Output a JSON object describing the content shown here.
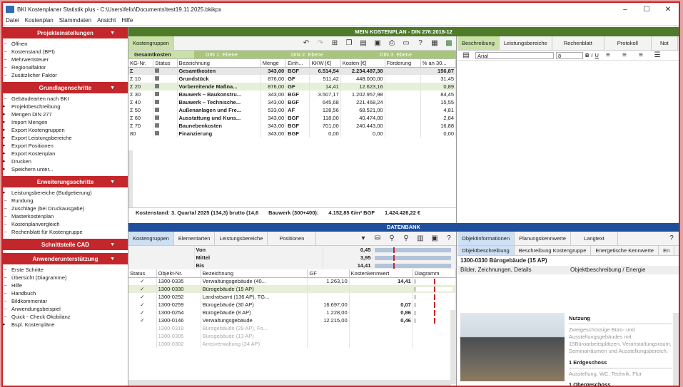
{
  "window": {
    "title": "BKI Kostenplaner Statistik plus - C:\\Users\\felix\\Documents\\test19.11.2025.bkikpx",
    "minimize": "–",
    "maximize": "☐",
    "close": "✕"
  },
  "menu": [
    "Datei",
    "Kostenplan",
    "Stammdaten",
    "Ansicht",
    "Hilfe"
  ],
  "sidebar": {
    "s1": {
      "title": "Projekteinstellungen",
      "items": [
        "Öffnen",
        "Kostenstand (BPI)",
        "Mehrwertsteuer",
        "Regionalfaktor",
        "Zusätzlicher Faktor"
      ]
    },
    "s2": {
      "title": "Grundlagenschritte",
      "items": [
        "Gebäudearten nach BKI",
        "Projektbeschreibung",
        "Mengen DIN 277",
        "Import Mengen",
        "Export Kostengruppen",
        "Export Leistungsbereiche",
        "Export Positionen",
        "Export Kostenplan",
        "Drucken",
        "Speichern unter..."
      ]
    },
    "s3": {
      "title": "Erweiterungsschritte",
      "items": [
        "Leistungsbereiche (Budgetierung)",
        "Rundung",
        "Zuschläge (bei Druckausgabe)",
        "Masterkostenplan",
        "Kostenplanvergleich",
        "Rechenblatt für Kostengruppe"
      ]
    },
    "s4": {
      "title": "Schnittstelle CAD"
    },
    "s5": {
      "title": "Anwenderunterstützung",
      "items": [
        "Erste Schritte",
        "Übersicht (Diagramme)",
        "Hilfe",
        "Handbuch",
        "Bildkommentar",
        "Anwendungsbeispiel",
        "Quick - Check Ökobilanz",
        "Bspl. Kostenpläne"
      ]
    }
  },
  "plan": {
    "header": "MEIN KOSTENPLAN - DIN 276:2018-12",
    "tab": "Kostengruppen",
    "ebene": [
      "Gesamtkosten",
      "DIN 1. Ebene",
      "DIN 2. Ebene",
      "DIN 3. Ebene"
    ],
    "cols": [
      "KG-Nr.",
      "Status",
      "Bezeichnung",
      "Menge",
      "Einh...",
      "KKW [€]",
      "Kosten [€]",
      "Förderung",
      "% an 30..."
    ],
    "rows": [
      [
        "Σ",
        "",
        "Gesamtkosten",
        "343,00",
        "BGF",
        "6.514,54",
        "2.234.487,38",
        "",
        "156,87"
      ],
      [
        "Σ 10",
        "",
        "Grundstück",
        "876,00",
        "GF",
        "511,42",
        "448.000,00",
        "",
        "31,45"
      ],
      [
        "Σ 20",
        "",
        "Vorbereitende Maßna...",
        "876,00",
        "GF",
        "14,41",
        "12.623,16",
        "",
        "0,89"
      ],
      [
        "Σ 30",
        "",
        "Bauwerk – Baukonstru...",
        "343,00",
        "BGF",
        "3.507,17",
        "1.202.957,98",
        "",
        "84,45"
      ],
      [
        "Σ 40",
        "",
        "Bauwerk – Technische...",
        "343,00",
        "BGF",
        "645,68",
        "221.468,24",
        "",
        "15,55"
      ],
      [
        "Σ 50",
        "",
        "Außenanlagen und Fre...",
        "533,00",
        "AF",
        "128,56",
        "68.521,00",
        "",
        "4,81"
      ],
      [
        "Σ 60",
        "",
        "Ausstattung und Kuns...",
        "343,00",
        "BGF",
        "118,00",
        "40.474,00",
        "",
        "2,84"
      ],
      [
        "Σ 70",
        "",
        "Baunebenkosten",
        "343,00",
        "BGF",
        "701,00",
        "240.443,00",
        "",
        "16,88"
      ],
      [
        "80",
        "",
        "Finanzierung",
        "343,00",
        "BGF",
        "0,00",
        "0,00",
        "",
        "0,00"
      ]
    ],
    "status": "Kostenstand: 3. Quartal 2025 (134,3) brutto (14,6",
    "bauwerk": "Bauwerk (300+400):",
    "kennwert": "4.152,85 €/m² BGF",
    "summe": "1.424.426,22 €"
  },
  "desc": {
    "tabs": [
      "Beschreibung",
      "Leistungsbereiche",
      "Rechenblatt",
      "Protokoll",
      "Not"
    ],
    "font": "Arial",
    "size": "8",
    "fmt": [
      "B",
      "I",
      "U"
    ]
  },
  "db": {
    "header": "DATENBANK",
    "tabs": [
      "Kostengruppen",
      "Elementarten",
      "Leistungsbereiche",
      "Positionen"
    ],
    "stats": [
      [
        "Von",
        "0,45"
      ],
      [
        "Mittel",
        "3,95"
      ],
      [
        "Bis",
        "14,41"
      ]
    ],
    "cols": [
      "Status",
      "Objekt-Nr.",
      "Bezeichnung",
      "GF",
      "Kostenkennwert",
      "Diagramm"
    ],
    "rows": [
      [
        "✓",
        "1300-0335",
        "Verwaltungsgebäude (40...",
        "1.263,10",
        "14,41"
      ],
      [
        "✓",
        "1300-0330",
        "Bürogebäude (15 AP)",
        "",
        ""
      ],
      [
        "✓",
        "1300-0292",
        "Landratsamt (136 AP), TG...",
        "",
        ""
      ],
      [
        "✓",
        "1300-0259",
        "Bürogebäude (30 AP)",
        "16.697,00",
        "0,07"
      ],
      [
        "✓",
        "1300-0254",
        "Bürogebäude (8 AP)",
        "1.228,00",
        "0,86"
      ],
      [
        "✓",
        "1300-0146",
        "Verwaltungsgebäude",
        "12.215,00",
        "0,46"
      ],
      [
        "",
        "1300-0318",
        "Bürogebäude (29 AP), Fo...",
        "",
        ""
      ],
      [
        "",
        "1300-0305",
        "Bürogebäude (13 AP)",
        "",
        ""
      ],
      [
        "",
        "1300-0302",
        "Amtsverwaltung (24 AP)",
        "",
        ""
      ]
    ]
  },
  "obj": {
    "tabs": [
      "Objektinformationen",
      "Planungskennwerte",
      "Langtext"
    ],
    "subtabs": [
      "Objektbeschreibung",
      "Beschreibung Kostengruppe",
      "Energetische Kennwerte",
      "En"
    ],
    "title": "1300-0330 Bürogebäude (15 AP)",
    "left": "Bilder, Zeichnungen, Details",
    "right": "Objektbeschreibung / Energie",
    "nutzung": "Nutzung",
    "text": "Zweigeschossige Büro- und Ausstellungsgebäudes mit 15Büroarbeitsplätzen, Veranstaltungsraum, Seminarräumen und Ausstellungsbereich.",
    "eg": "1 Erdgeschoss",
    "egtext": "Ausstellung, WC, Technik, Flur",
    "og": "1 Obergeschoss"
  }
}
